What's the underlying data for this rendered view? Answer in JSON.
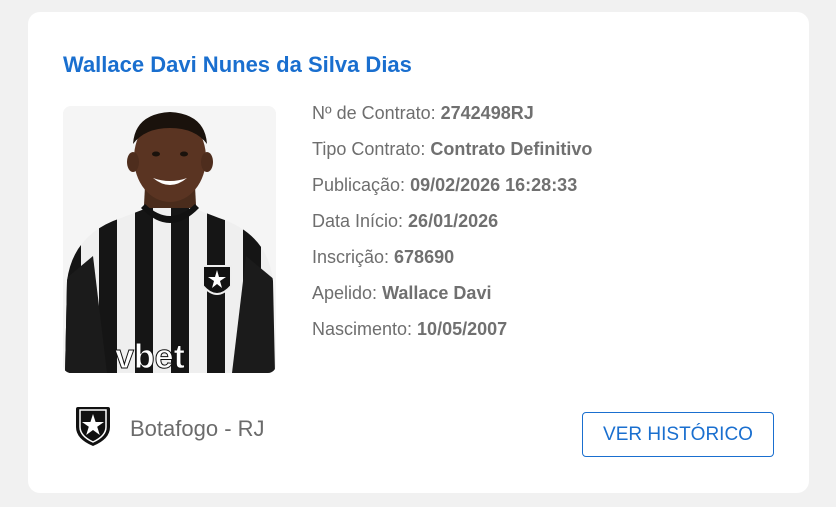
{
  "player": {
    "name": "Wallace Davi Nunes da Silva Dias"
  },
  "fields": [
    {
      "label": "Nº de Contrato: ",
      "value": "2742498RJ"
    },
    {
      "label": "Tipo Contrato: ",
      "value": "Contrato Definitivo"
    },
    {
      "label": "Publicação: ",
      "value": "09/02/2026 16:28:33"
    },
    {
      "label": "Data Início: ",
      "value": "26/01/2026"
    },
    {
      "label": "Inscrição: ",
      "value": "678690"
    },
    {
      "label": "Apelido: ",
      "value": "Wallace Davi"
    },
    {
      "label": "Nascimento: ",
      "value": "10/05/2007"
    }
  ],
  "club": {
    "name": "Botafogo - RJ",
    "crest_icon": "botafogo-star-shield-icon"
  },
  "photo": {
    "shirt_text": "vbet"
  },
  "actions": {
    "history_label": "VER HISTÓRICO"
  },
  "colors": {
    "accent": "#1a6fcf",
    "text": "#6e6e6e"
  }
}
